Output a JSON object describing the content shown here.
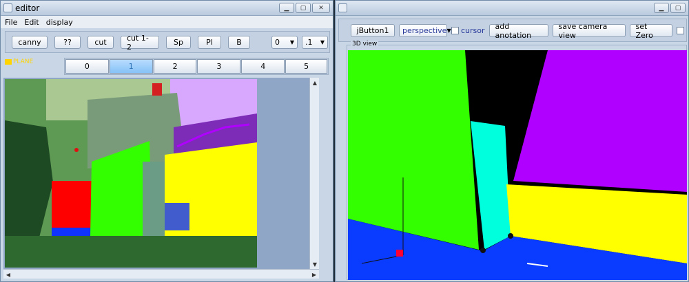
{
  "editor": {
    "title": "editor",
    "menu": [
      "File",
      "Edit",
      "display"
    ],
    "toolbar_buttons": [
      "canny",
      "??",
      "cut",
      "cut 1-2",
      "Sp",
      "Pl",
      "B"
    ],
    "combo_a": "0",
    "combo_b": ".1",
    "plane_label": "PLANE",
    "tabs": [
      "0",
      "1",
      "2",
      "3",
      "4",
      "5"
    ],
    "active_tab": 1
  },
  "viewer": {
    "jbutton_label": "jButton1",
    "projection": "perspective",
    "cursor_label": "cursor",
    "add_annotation": "add anotation",
    "save_camera": "save camera view",
    "set_zero": "set Zero",
    "panel_title": "3D view"
  },
  "colors": {
    "plane_red": "#ff0000",
    "plane_green": "#33ff00",
    "plane_yellow": "#ffff00",
    "plane_purple": "#b000ff",
    "plane_cyan": "#00ffdd",
    "plane_blue": "#0a3cff",
    "accent_blue": "#2a6fb5"
  }
}
